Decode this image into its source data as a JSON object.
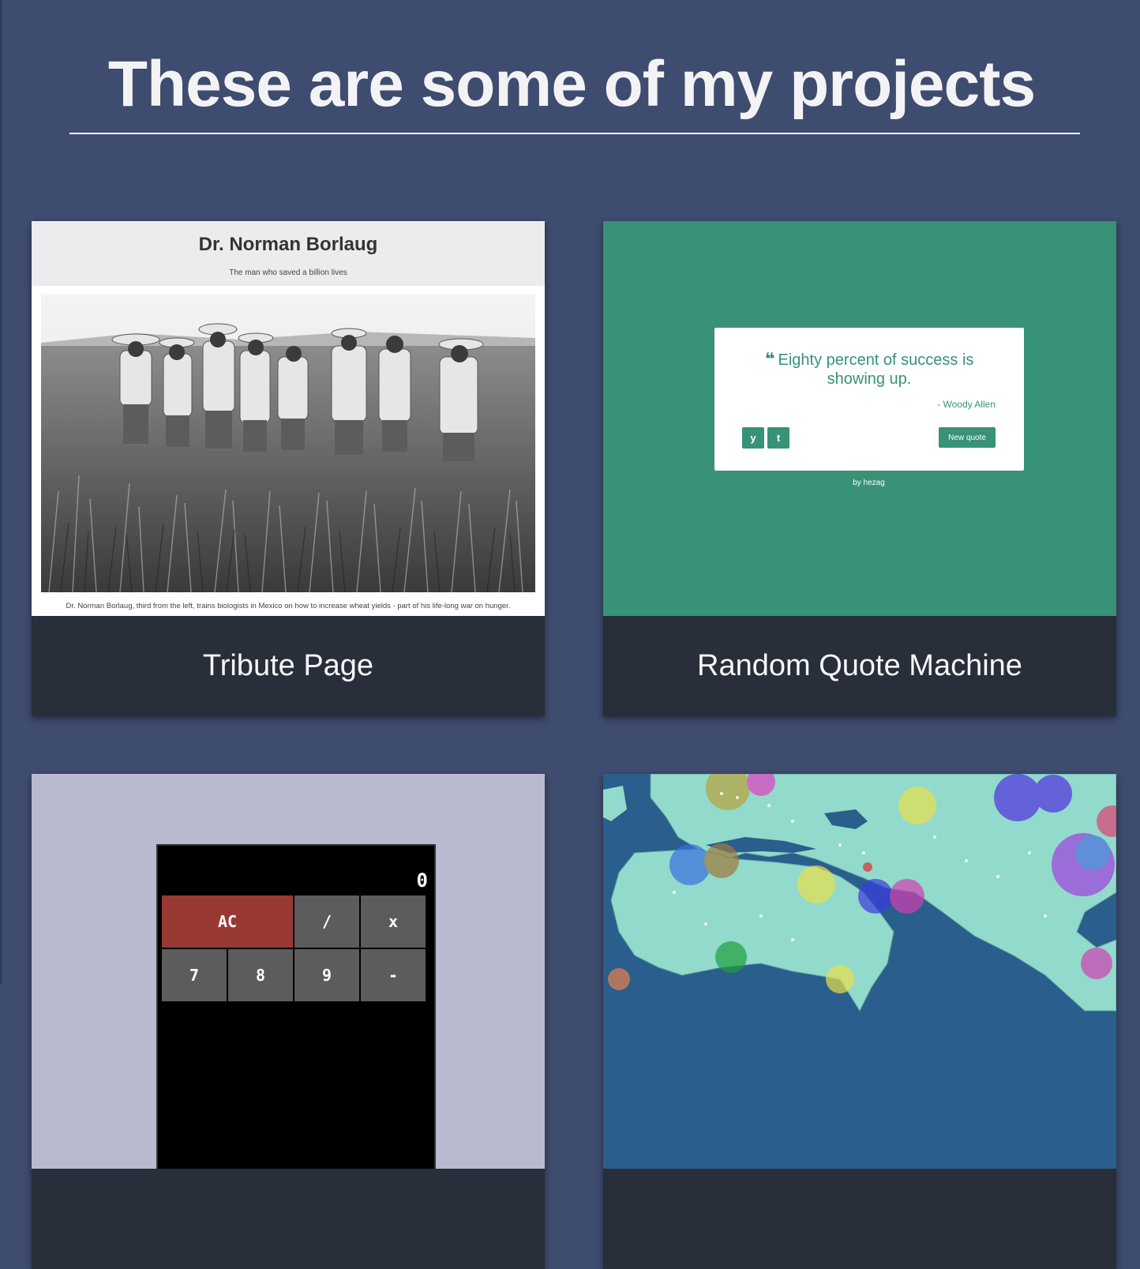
{
  "page": {
    "title": "These are some of my projects"
  },
  "projects": [
    {
      "caption": "Tribute Page",
      "preview": {
        "heading": "Dr. Norman Borlaug",
        "subheading": "The man who saved a billion lives",
        "photo_caption": "Dr. Norman Borlaug, third from the left, trains biologists in Mexico on how to increase wheat yields - part of his life-long war on hunger."
      }
    },
    {
      "caption": "Random Quote Machine",
      "preview": {
        "quote_mark": "❝",
        "quote": "Eighty percent of success is showing up.",
        "author": "- Woody Allen",
        "twitter_glyph": "y",
        "tumblr_glyph": "t",
        "new_quote_label": "New quote",
        "byline": "by hezag"
      }
    },
    {
      "caption": "",
      "preview": {
        "display": "0",
        "keys": [
          "AC",
          "/",
          "x",
          "7",
          "8",
          "9",
          "-"
        ]
      }
    },
    {
      "caption": "",
      "preview": {}
    }
  ],
  "colors": {
    "page_bg": "#3e4c6f",
    "caption_bar": "#282e3a",
    "quote_green": "#379277",
    "calc_bg": "#b9b9cf",
    "calc_ac": "#983a33",
    "map_ocean": "#2a5e8c",
    "map_land": "#92dacb"
  }
}
